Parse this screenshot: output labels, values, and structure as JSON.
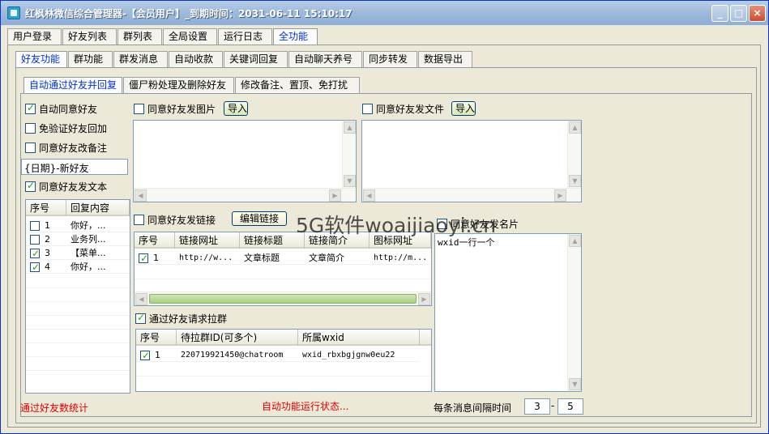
{
  "window": {
    "title": "红枫林微信综合管理器-【会员用户】_到期时间：2031-06-11 15:10:17",
    "controls": {
      "minimize": "_",
      "maximize": "□",
      "close": "×"
    }
  },
  "main_tabs": [
    "用户登录",
    "好友列表",
    "群列表",
    "全局设置",
    "运行日志",
    "全功能"
  ],
  "sub_tabs": [
    "好友功能",
    "群功能",
    "群发消息",
    "自动收款",
    "关键词回复",
    "自动聊天养号",
    "同步转发",
    "数据导出"
  ],
  "third_tabs": [
    "自动通过好友并回复",
    "僵尸粉处理及删除好友",
    "修改备注、置顶、免打扰"
  ],
  "left": {
    "auto_accept": "自动同意好友",
    "no_verify": "免验证好友回加",
    "remark": "同意好友改备注",
    "remark_value": "{日期}-新好友",
    "send_text": "同意好友发文本",
    "reply_table": {
      "headers": [
        "序号",
        "回复内容"
      ],
      "rows": [
        {
          "no": "1",
          "content": "你好，..."
        },
        {
          "no": "2",
          "content": "业务列..."
        },
        {
          "no": "3",
          "content": "【菜单..."
        },
        {
          "no": "4",
          "content": "你好，..."
        }
      ]
    }
  },
  "images": {
    "label": "同意好友发图片",
    "import": "导入"
  },
  "files": {
    "label": "同意好友发文件",
    "import": "导入"
  },
  "links": {
    "label": "同意好友发链接",
    "edit": "编辑链接",
    "headers": [
      "序号",
      "链接网址",
      "链接标题",
      "链接简介",
      "图标网址"
    ],
    "rows": [
      {
        "no": "1",
        "url": "http://w...",
        "title": "文章标题",
        "desc": "文章简介",
        "icon": "http://m..."
      }
    ]
  },
  "card": {
    "label": "同意好友发名片",
    "placeholder": "wxid一行一个"
  },
  "group_invite": {
    "label": "通过好友请求拉群",
    "headers": [
      "序号",
      "待拉群ID(可多个)",
      "所属wxid"
    ],
    "rows": [
      {
        "no": "1",
        "room": "220719921450@chatroom",
        "wxid": "wxid_rbxbgjgnw0eu22"
      }
    ]
  },
  "footer": {
    "stat_label": "通过好友数统计",
    "status_label": "自动功能运行状态...",
    "interval_label": "每条消息间隔时间",
    "min": "3",
    "dash": "-",
    "max": "5"
  },
  "watermark": "5G软件woaijiaoyi.cn"
}
